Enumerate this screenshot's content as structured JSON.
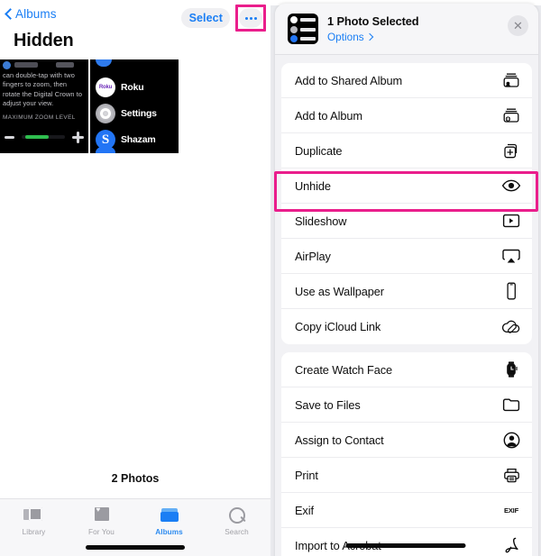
{
  "left_panel": {
    "nav": {
      "back_label": "Albums",
      "back_icon": "chevron-left-icon",
      "select_label": "Select",
      "more_icon": "ellipsis-icon"
    },
    "page_title": "Hidden",
    "photo_count": "2 Photos",
    "thumbnails": [
      {
        "name": "watch-zoom-settings-screenshot",
        "body_text": "can double-tap with two fingers to zoom, then rotate the Digital Crown to adjust your view.",
        "section_label": "MAXIMUM ZOOM LEVEL",
        "minus_label": "−",
        "plus_label": "+"
      },
      {
        "name": "watch-app-list-screenshot",
        "apps": [
          {
            "name": "Roku",
            "icon_text": "Roku"
          },
          {
            "name": "Settings",
            "icon_text": ""
          },
          {
            "name": "Shazam",
            "icon_text": "S"
          }
        ]
      }
    ],
    "tabs": [
      {
        "label": "Library",
        "icon": "photo-stack-icon",
        "active": false
      },
      {
        "label": "For You",
        "icon": "heart-card-icon",
        "active": false
      },
      {
        "label": "Albums",
        "icon": "albums-folder-icon",
        "active": true
      },
      {
        "label": "Search",
        "icon": "search-icon",
        "active": false
      }
    ]
  },
  "share_sheet": {
    "header": {
      "title": "1 Photo Selected",
      "options_label": "Options",
      "options_chevron": "chevron-right-icon",
      "close_icon": "close-icon"
    },
    "groups": [
      {
        "items": [
          {
            "label": "Add to Shared Album",
            "icon": "shared-album-icon"
          },
          {
            "label": "Add to Album",
            "icon": "add-album-icon"
          },
          {
            "label": "Duplicate",
            "icon": "duplicate-icon"
          },
          {
            "label": "Unhide",
            "icon": "eye-icon",
            "highlighted": true
          },
          {
            "label": "Slideshow",
            "icon": "play-rectangle-icon"
          },
          {
            "label": "AirPlay",
            "icon": "airplay-icon"
          },
          {
            "label": "Use as Wallpaper",
            "icon": "phone-icon"
          },
          {
            "label": "Copy iCloud Link",
            "icon": "icloud-link-icon"
          }
        ]
      },
      {
        "items": [
          {
            "label": "Create Watch Face",
            "icon": "watch-icon"
          },
          {
            "label": "Save to Files",
            "icon": "folder-icon"
          },
          {
            "label": "Assign to Contact",
            "icon": "person-circle-icon"
          },
          {
            "label": "Print",
            "icon": "printer-icon"
          },
          {
            "label": "Exif",
            "icon": "exif-text-icon",
            "icon_text": "EXIF"
          },
          {
            "label": "Import to Acrobat",
            "icon": "acrobat-icon"
          }
        ]
      }
    ]
  },
  "colors": {
    "accent_blue": "#1a7ef4",
    "highlight_pink": "#ea1e8c",
    "sheet_background": "#f2f2f5",
    "panel_background": "#e9eaee"
  }
}
